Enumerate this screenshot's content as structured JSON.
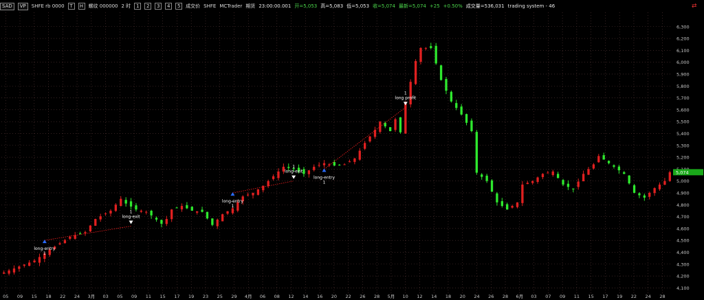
{
  "toolbar": {
    "btn_scale": "SAD",
    "btn_vp": "VP",
    "symbol": "SHFE rb 0000",
    "btn_t": "T",
    "btn_h": "H",
    "contract_desc": "螺纹 000000",
    "period": "2 时",
    "btn_1": "1",
    "btn_2": "2",
    "btn_3": "3",
    "btn_4": "4",
    "btn_5": "5",
    "chain": "成交价",
    "exchange": "SHFE",
    "vendor": "MCTrader",
    "mode": "期货",
    "time": "23:00:00.001",
    "open": "开=5,053",
    "high": "高=5,083",
    "low": "低=5,053",
    "close": "收=5,074",
    "last": "最新=5,074",
    "change": "+25",
    "pct": "+0.50%",
    "volume": "成交量=536,031",
    "strategy": "trading system - 46"
  },
  "chart_data": {
    "type": "candlestick",
    "ylim": [
      4050,
      6420
    ],
    "y_ticks": [
      4100,
      4200,
      4300,
      4400,
      4500,
      4600,
      4700,
      4800,
      4900,
      5000,
      5100,
      5200,
      5300,
      5400,
      5500,
      5600,
      5700,
      5800,
      5900,
      6000,
      6100,
      6200,
      6300
    ],
    "y_tick_labels": [
      "4,100",
      "4,200",
      "4,300",
      "4,400",
      "4,500",
      "4,600",
      "4,700",
      "4,800",
      "4,900",
      "5,000",
      "5,100",
      "5,200",
      "5,300",
      "5,400",
      "5,500",
      "5,600",
      "5,700",
      "5,800",
      "5,900",
      "6,000",
      "6,100",
      "6,200",
      "6,300"
    ],
    "last_price_label": "5,074",
    "last_price": 5074,
    "x_tick_labels": [
      "05",
      "09",
      "15",
      "18",
      "22",
      "24",
      "3月",
      "03",
      "05",
      "09",
      "11",
      "15",
      "17",
      "19",
      "23",
      "25",
      "29",
      "4月",
      "06",
      "08",
      "12",
      "14",
      "16",
      "20",
      "22",
      "26",
      "28",
      "5月",
      "10",
      "12",
      "14",
      "18",
      "20",
      "24",
      "26",
      "28",
      "6月",
      "03",
      "07",
      "09",
      "11",
      "15",
      "17",
      "19",
      "22",
      "24",
      "28"
    ],
    "bars": 120,
    "close_path": [
      [
        0,
        4230
      ],
      [
        6,
        4330
      ],
      [
        9,
        4420
      ],
      [
        13,
        4530
      ],
      [
        16,
        4570
      ],
      [
        18,
        4680
      ],
      [
        21,
        4750
      ],
      [
        23,
        4850
      ],
      [
        24,
        4810
      ],
      [
        26,
        4760
      ],
      [
        28,
        4740
      ],
      [
        29,
        4710
      ],
      [
        31,
        4640
      ],
      [
        32,
        4680
      ],
      [
        33,
        4760
      ],
      [
        35,
        4790
      ],
      [
        37,
        4750
      ],
      [
        39,
        4740
      ],
      [
        41,
        4630
      ],
      [
        43,
        4720
      ],
      [
        45,
        4770
      ],
      [
        47,
        4870
      ],
      [
        49,
        4900
      ],
      [
        51,
        4960
      ],
      [
        53,
        5040
      ],
      [
        55,
        5120
      ],
      [
        57,
        5100
      ],
      [
        59,
        5060
      ],
      [
        61,
        5120
      ],
      [
        63,
        5150
      ],
      [
        65,
        5130
      ],
      [
        67,
        5140
      ],
      [
        69,
        5190
      ],
      [
        71,
        5320
      ],
      [
        73,
        5430
      ],
      [
        74,
        5500
      ],
      [
        76,
        5420
      ],
      [
        77,
        5520
      ],
      [
        78,
        5410
      ],
      [
        79,
        5660
      ],
      [
        81,
        6010
      ],
      [
        82,
        6120
      ],
      [
        84,
        6120
      ],
      [
        85,
        5990
      ],
      [
        86,
        5850
      ],
      [
        88,
        5670
      ],
      [
        90,
        5560
      ],
      [
        92,
        5420
      ],
      [
        93,
        5070
      ],
      [
        95,
        5000
      ],
      [
        97,
        4820
      ],
      [
        99,
        4760
      ],
      [
        101,
        4820
      ],
      [
        102,
        4970
      ],
      [
        104,
        5000
      ],
      [
        106,
        5060
      ],
      [
        108,
        5080
      ],
      [
        110,
        4970
      ],
      [
        112,
        4930
      ],
      [
        114,
        5060
      ],
      [
        116,
        5140
      ],
      [
        117,
        5210
      ],
      [
        118,
        5180
      ],
      [
        120,
        5120
      ],
      [
        122,
        5060
      ],
      [
        124,
        4900
      ],
      [
        126,
        4860
      ],
      [
        128,
        4940
      ],
      [
        130,
        5000
      ],
      [
        131,
        5074
      ]
    ],
    "signals": [
      {
        "type": "long-entry",
        "bar": 8,
        "price": 4500,
        "label": "long-entry",
        "qty": "1"
      },
      {
        "type": "long-exit",
        "bar": 25,
        "price": 4620,
        "label": "long-exit",
        "qty": "1"
      },
      {
        "type": "long-entry",
        "bar": 45,
        "price": 4900,
        "label": "long-entry",
        "qty": "1"
      },
      {
        "type": "long-exit",
        "bar": 57,
        "price": 5000,
        "label": "long-exit",
        "qty": "1"
      },
      {
        "type": "long-entry",
        "bar": 63,
        "price": 5100,
        "label": "long-entry",
        "qty": "1"
      },
      {
        "type": "long profit",
        "bar": 79,
        "price": 5620,
        "label": "long profit",
        "qty": "1"
      }
    ],
    "colors": {
      "up": "#e02020",
      "down": "#2ee82e",
      "grid": "#5a3a3a",
      "axis_text": "#c8c8c8",
      "trade_line": "#ff2020",
      "last_price_bg": "#1aa81a"
    },
    "grid": true
  }
}
